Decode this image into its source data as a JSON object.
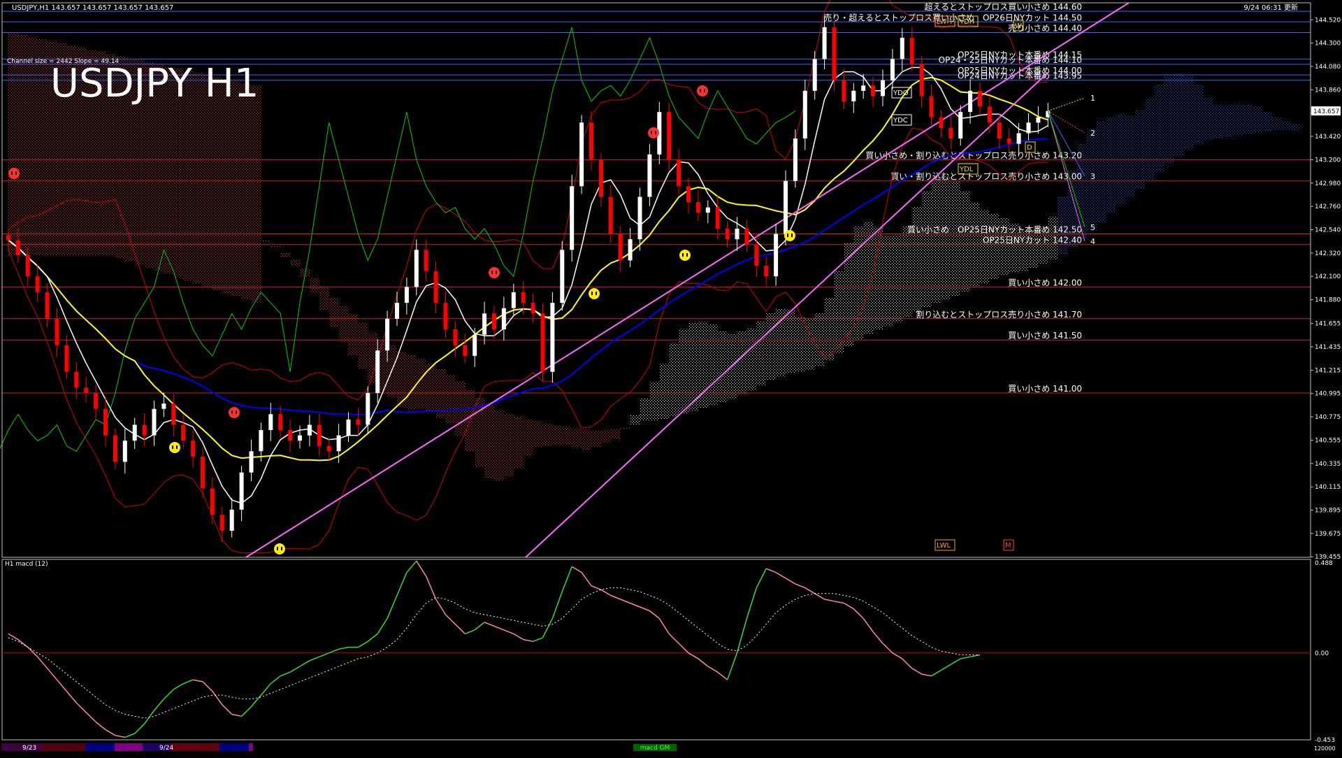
{
  "header": {
    "symbol_info": "USDJPY,H1  143.657 143.657 143.657 143.657",
    "timestamp": "9/24 06:31 更新",
    "channel_info": "Channel size = 2442 Slope = 49.14",
    "big_title": "USDJPY H1"
  },
  "colors": {
    "background": "#000000",
    "frame": "#c0c0c0",
    "bull_candle": "#ffffff",
    "bear_candle": "#ff0000",
    "kumo_bear": "#ff2a2a",
    "kumo_bull": "#e8e8e8",
    "kumo_future": "#3050ff",
    "tenkan": "#ffffff",
    "kijun": "#ffff00",
    "ma_blue": "#0000ff",
    "chikou": "#00d000",
    "bollinger": "#d00000",
    "channel": "#ff66ff",
    "macd_up": "#33dd33",
    "macd_down": "#ff88aa",
    "macd_signal": "#ffffff",
    "level_line": "#d02020",
    "blue_line": "#4060ff"
  },
  "chart_data": {
    "type": "candlestick",
    "title": "USDJPY H1",
    "ylim": [
      139.45,
      144.68
    ],
    "price_ticks": [
      "144.520",
      "144.300",
      "144.080",
      "143.860",
      "143.640",
      "143.420",
      "143.200",
      "142.980",
      "142.760",
      "142.540",
      "142.320",
      "142.100",
      "141.880",
      "141.655",
      "141.435",
      "141.215",
      "140.995",
      "140.775",
      "140.555",
      "140.335",
      "140.115",
      "139.895",
      "139.675",
      "139.455"
    ],
    "current_price": "143.657",
    "closes": [
      142.44,
      142.3,
      142.1,
      141.95,
      141.7,
      141.45,
      141.2,
      141.05,
      141.0,
      140.85,
      140.6,
      140.35,
      140.55,
      140.7,
      140.6,
      140.85,
      140.9,
      140.7,
      140.55,
      140.4,
      140.1,
      139.85,
      139.7,
      139.9,
      140.25,
      140.45,
      140.65,
      140.8,
      140.65,
      140.55,
      140.6,
      140.7,
      140.5,
      140.45,
      140.6,
      140.75,
      140.7,
      141.0,
      141.4,
      141.7,
      141.85,
      142.0,
      142.35,
      142.15,
      141.85,
      141.6,
      141.45,
      141.35,
      141.55,
      141.75,
      141.6,
      141.8,
      141.95,
      141.85,
      141.75,
      141.2,
      141.85,
      142.35,
      142.95,
      143.55,
      143.2,
      142.85,
      142.5,
      142.25,
      142.45,
      142.85,
      143.25,
      143.65,
      143.2,
      142.95,
      142.8,
      142.7,
      142.75,
      142.55,
      142.45,
      142.55,
      142.4,
      142.2,
      142.1,
      142.5,
      143.0,
      143.4,
      143.85,
      144.15,
      144.45,
      143.95,
      143.75,
      143.85,
      143.9,
      143.8,
      143.95,
      144.15,
      144.35,
      144.1,
      143.8,
      143.6,
      143.5,
      143.4,
      143.65,
      143.85,
      143.7,
      143.55,
      143.4,
      143.35,
      143.45,
      143.55,
      143.6,
      143.66
    ],
    "levels": [
      {
        "label": "超えるとストップロス買い小さめ 144.60",
        "value": 144.6
      },
      {
        "label": "売り・超えるとストップロス買い小さめ　OP26日NYカット 144.50",
        "value": 144.5
      },
      {
        "label": "売り小さめ 144.40",
        "value": 144.4
      },
      {
        "label": "OP25日NYカット本番め 144.15",
        "value": 144.15
      },
      {
        "label": "OP24・25日NYカット本番め 144.10",
        "value": 144.1
      },
      {
        "label": "OP25日NYカット本番め 144.00",
        "value": 144.0
      },
      {
        "label": "OP24日NYカット本番め 143.95",
        "value": 143.95
      },
      {
        "label": "買い小さめ・割り込むとストップロス売り小さめ 143.20",
        "value": 143.2
      },
      {
        "label": "買い・割り込むとストップロス売り小さめ 143.00",
        "value": 143.0
      },
      {
        "label": "買い小さめ　OP25日NYカット本番め 142.50",
        "value": 142.5
      },
      {
        "label": "OP25日NYカット 142.40",
        "value": 142.4
      },
      {
        "label": "買い小さめ 142.00",
        "value": 142.0
      },
      {
        "label": "割り込むとストップロス売り小さめ 141.70",
        "value": 141.7
      },
      {
        "label": "買い小さめ 141.50",
        "value": 141.5
      },
      {
        "label": "買い小さめ 141.00",
        "value": 141.0
      }
    ],
    "projection_labels": [
      "1",
      "2",
      "3",
      "4",
      "5"
    ],
    "box_labels": {
      "ydh": "YDH",
      "ydl": "YDL",
      "ydo": "YDO",
      "ydc": "YDC",
      "lwh": "LWH",
      "lwl": "LWL",
      "d": "D",
      "w": "W",
      "m": "M"
    },
    "macd": {
      "label": "H1  macd (12)",
      "ylim": [
        -0.453,
        0.488
      ],
      "ticks": [
        "0.488",
        "0.00",
        "-0.453"
      ],
      "values": [
        0.1,
        0.07,
        0.03,
        -0.02,
        -0.08,
        -0.14,
        -0.2,
        -0.26,
        -0.31,
        -0.36,
        -0.4,
        -0.43,
        -0.44,
        -0.42,
        -0.37,
        -0.3,
        -0.24,
        -0.19,
        -0.16,
        -0.14,
        -0.15,
        -0.2,
        -0.27,
        -0.32,
        -0.33,
        -0.28,
        -0.22,
        -0.16,
        -0.12,
        -0.1,
        -0.07,
        -0.04,
        -0.02,
        0.0,
        0.02,
        0.03,
        0.03,
        0.06,
        0.1,
        0.18,
        0.3,
        0.42,
        0.48,
        0.4,
        0.28,
        0.2,
        0.15,
        0.1,
        0.12,
        0.16,
        0.14,
        0.12,
        0.1,
        0.07,
        0.06,
        0.08,
        0.18,
        0.32,
        0.45,
        0.42,
        0.35,
        0.33,
        0.3,
        0.28,
        0.26,
        0.24,
        0.22,
        0.18,
        0.1,
        0.05,
        0.0,
        -0.03,
        -0.07,
        -0.1,
        -0.14,
        0.0,
        0.18,
        0.34,
        0.44,
        0.42,
        0.39,
        0.36,
        0.34,
        0.31,
        0.28,
        0.27,
        0.26,
        0.23,
        0.18,
        0.11,
        0.05,
        0.0,
        -0.03,
        -0.08,
        -0.11,
        -0.12,
        -0.09,
        -0.06,
        -0.03,
        -0.02,
        -0.01
      ],
      "signal": [
        0.08,
        0.06,
        0.03,
        0.0,
        -0.03,
        -0.07,
        -0.11,
        -0.15,
        -0.19,
        -0.23,
        -0.27,
        -0.3,
        -0.32,
        -0.33,
        -0.34,
        -0.33,
        -0.31,
        -0.29,
        -0.27,
        -0.25,
        -0.23,
        -0.22,
        -0.22,
        -0.23,
        -0.24,
        -0.24,
        -0.23,
        -0.21,
        -0.19,
        -0.17,
        -0.15,
        -0.13,
        -0.11,
        -0.09,
        -0.07,
        -0.05,
        -0.03,
        -0.02,
        0.0,
        0.03,
        0.07,
        0.13,
        0.2,
        0.26,
        0.29,
        0.28,
        0.26,
        0.23,
        0.21,
        0.2,
        0.19,
        0.18,
        0.17,
        0.16,
        0.15,
        0.14,
        0.15,
        0.18,
        0.23,
        0.28,
        0.31,
        0.33,
        0.34,
        0.34,
        0.33,
        0.32,
        0.3,
        0.28,
        0.25,
        0.21,
        0.17,
        0.13,
        0.09,
        0.05,
        0.02,
        0.01,
        0.04,
        0.09,
        0.15,
        0.21,
        0.25,
        0.28,
        0.3,
        0.31,
        0.31,
        0.31,
        0.3,
        0.29,
        0.27,
        0.24,
        0.21,
        0.17,
        0.13,
        0.09,
        0.06,
        0.03,
        0.01,
        0.0,
        -0.01,
        -0.01,
        -0.01
      ]
    }
  },
  "footer": {
    "date1": "9/23",
    "date2": "9/24",
    "center": "macd GM",
    "right": "120000"
  }
}
